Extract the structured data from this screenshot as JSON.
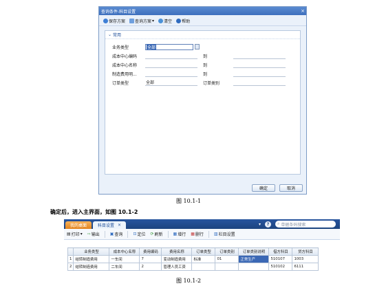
{
  "dialog": {
    "title": "查询条件-科目设置",
    "close": "×",
    "toolbar": {
      "save_scheme": "保存方案",
      "query_scheme": "查询方案",
      "clear": "清空",
      "help": "帮助"
    },
    "section": "常用",
    "fields": {
      "business_type_label": "业务类型",
      "business_type_value": "全部",
      "cost_center_code_label": "成本中心编码",
      "cost_center_name_label": "成本中心名称",
      "mfg_expense_label": "制造费用明...",
      "to_label": "到",
      "order_type_label": "订单类型",
      "order_type_value": "全部",
      "order_category_label": "订单类别"
    },
    "ok": "确定",
    "cancel": "取消"
  },
  "caption1": "图  10.1-1",
  "paragraph": "确定后，进入主界面，如图 10.1-2",
  "main": {
    "tabs": {
      "home": "我的桌面",
      "active": "科目设置",
      "close": "×"
    },
    "search_placeholder": "单据条码搜索",
    "toolbar": {
      "print": "打印",
      "export": "输出",
      "query": "查询",
      "locate": "定位",
      "refresh": "刷新",
      "add_row": "增行",
      "delete_row": "删行",
      "column_settings": "栏目设置"
    },
    "table": {
      "headers": [
        "业务类型",
        "成本中心名称",
        "费用编码",
        "费用名称",
        "订单类型",
        "订单类别",
        "订单类别说明",
        "借方科目",
        "贷方科目"
      ],
      "rows": [
        {
          "no": "1",
          "cells": [
            "结转制造费用",
            "一车间",
            "7",
            "变动制造费用",
            "标准",
            "01",
            "正常生产",
            "510107",
            "1003"
          ]
        },
        {
          "no": "2",
          "cells": [
            "结转制造费用",
            "二车间",
            "2",
            "管理人员工资",
            "",
            "",
            "",
            "510102",
            "6111"
          ]
        }
      ]
    }
  },
  "caption2": "图  10.1-2",
  "colors": {
    "titlebar": "#3d6fbd",
    "home_tab": "#e2841f",
    "selection": "#3b68b5"
  }
}
